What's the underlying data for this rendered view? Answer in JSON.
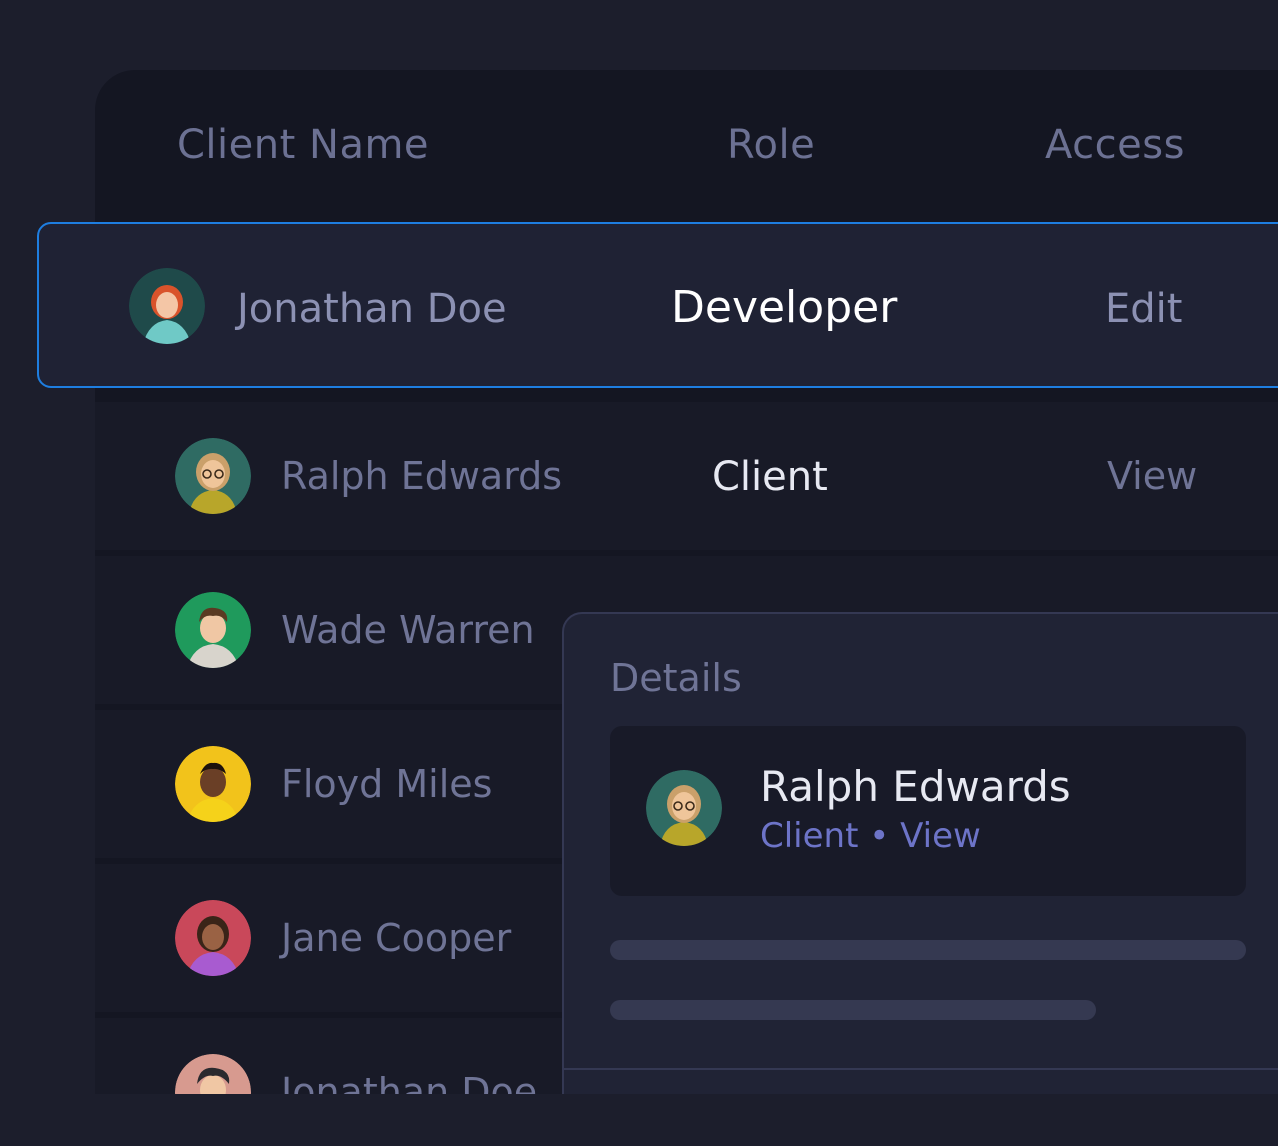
{
  "table": {
    "headers": {
      "name": "Client Name",
      "role": "Role",
      "access": "Access"
    },
    "selected_row": {
      "name": "Jonathan Doe",
      "role": "Developer",
      "access": "Edit",
      "avatar_color": "#1f4a4a"
    },
    "rows": [
      {
        "name": "Ralph Edwards",
        "role": "Client",
        "access": "View",
        "avatar_color": "#2f6b63"
      },
      {
        "name": "Wade Warren",
        "role": "",
        "access": "",
        "avatar_color": "#1f9a5c"
      },
      {
        "name": "Floyd Miles",
        "role": "",
        "access": "",
        "avatar_color": "#f2c31b"
      },
      {
        "name": "Jane Cooper",
        "role": "",
        "access": "",
        "avatar_color": "#c9485a"
      },
      {
        "name": "Jonathan Doe",
        "role": "",
        "access": "",
        "avatar_color": "#d79a8f"
      }
    ]
  },
  "details": {
    "title": "Details",
    "name": "Ralph Edwards",
    "role": "Client",
    "separator": "•",
    "access": "View"
  },
  "colors": {
    "selection_border": "#1e7ee0",
    "accent_text": "#6d74c8"
  }
}
